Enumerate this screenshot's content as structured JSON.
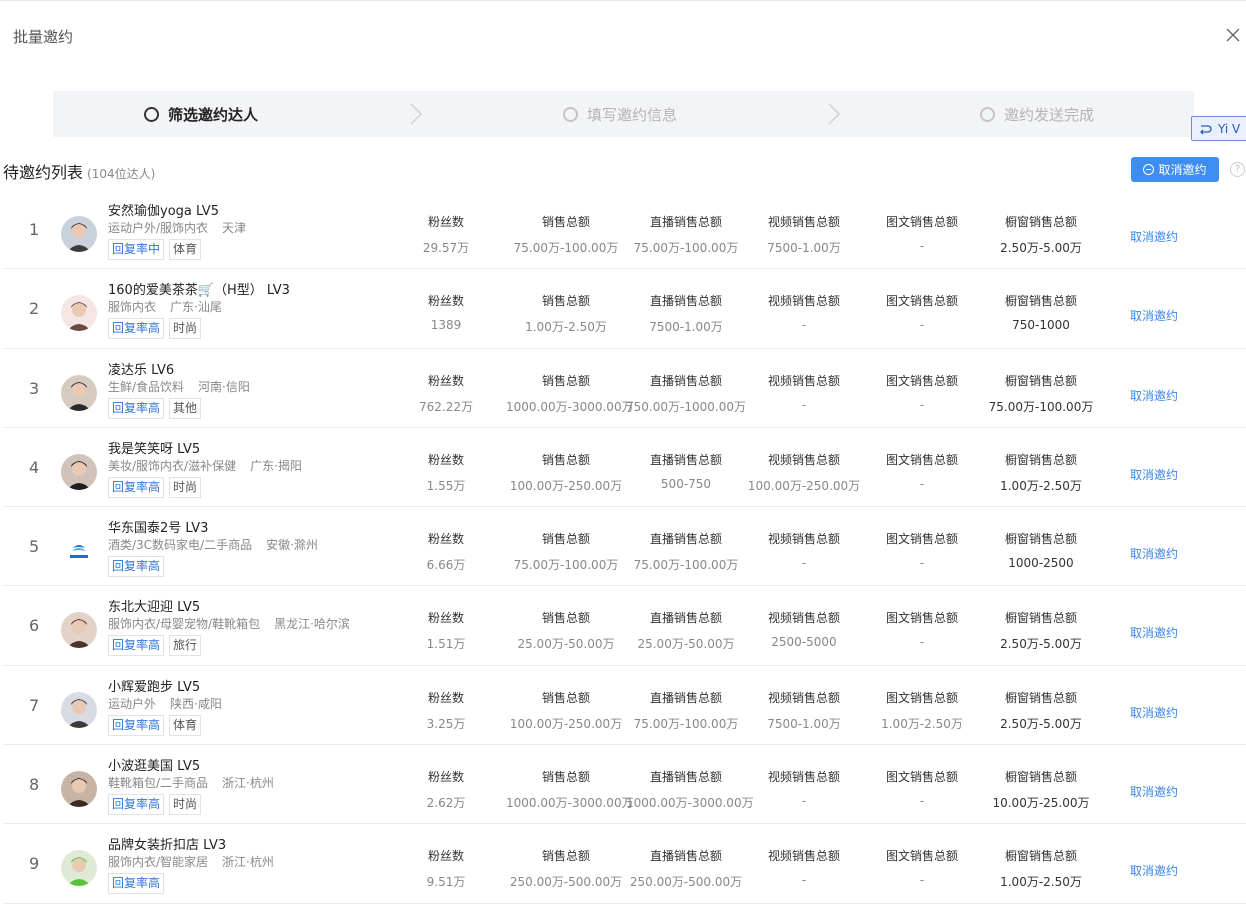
{
  "modal": {
    "title": "批量邀约"
  },
  "steps": [
    {
      "label": "筛选邀约达人"
    },
    {
      "label": "填写邀约信息"
    },
    {
      "label": "邀约发送完成"
    }
  ],
  "side_tab": {
    "label": "Yi V"
  },
  "list": {
    "title": "待邀约列表",
    "count": "(104位达人)",
    "cancel_all_label": "取消邀约",
    "help": "?",
    "stat_labels": [
      "粉丝数",
      "销售总额",
      "直播销售总额",
      "视频销售总额",
      "图文销售总额",
      "橱窗销售总额"
    ],
    "action_label": "取消邀约",
    "rows": [
      {
        "index": "1",
        "name": "安然瑜伽yoga LV5",
        "category": "运动户外/服饰内衣",
        "location": "天津",
        "tags": [
          "回复率中",
          "体育"
        ],
        "values": [
          "29.57万",
          "75.00万-100.00万",
          "75.00万-100.00万",
          "7500-1.00万",
          "-",
          "2.50万-5.00万"
        ]
      },
      {
        "index": "2",
        "name": "160的爱美茶茶🛒（H型） LV3",
        "category": "服饰内衣",
        "location": "广东·汕尾",
        "tags": [
          "回复率高",
          "时尚"
        ],
        "values": [
          "1389",
          "1.00万-2.50万",
          "7500-1.00万",
          "-",
          "-",
          "750-1000"
        ]
      },
      {
        "index": "3",
        "name": "凌达乐 LV6",
        "category": "生鲜/食品饮料",
        "location": "河南·信阳",
        "tags": [
          "回复率高",
          "其他"
        ],
        "values": [
          "762.22万",
          "1000.00万-3000.00万",
          "750.00万-1000.00万",
          "-",
          "-",
          "75.00万-100.00万"
        ]
      },
      {
        "index": "4",
        "name": "我是笑笑呀 LV5",
        "category": "美妆/服饰内衣/滋补保健",
        "location": "广东·揭阳",
        "tags": [
          "回复率高",
          "时尚"
        ],
        "values": [
          "1.55万",
          "100.00万-250.00万",
          "500-750",
          "100.00万-250.00万",
          "-",
          "1.00万-2.50万"
        ]
      },
      {
        "index": "5",
        "name": "华东国泰2号 LV3",
        "category": "酒类/3C数码家电/二手商品",
        "location": "安徽·滁州",
        "tags": [
          "回复率高"
        ],
        "values": [
          "6.66万",
          "75.00万-100.00万",
          "75.00万-100.00万",
          "-",
          "-",
          "1000-2500"
        ]
      },
      {
        "index": "6",
        "name": "东北大迎迎 LV5",
        "category": "服饰内衣/母婴宠物/鞋靴箱包",
        "location": "黑龙江·哈尔滨",
        "tags": [
          "回复率高",
          "旅行"
        ],
        "values": [
          "1.51万",
          "25.00万-50.00万",
          "25.00万-50.00万",
          "2500-5000",
          "-",
          "2.50万-5.00万"
        ]
      },
      {
        "index": "7",
        "name": "小辉爱跑步 LV5",
        "category": "运动户外",
        "location": "陕西·咸阳",
        "tags": [
          "回复率高",
          "体育"
        ],
        "values": [
          "3.25万",
          "100.00万-250.00万",
          "75.00万-100.00万",
          "7500-1.00万",
          "1.00万-2.50万",
          "2.50万-5.00万"
        ]
      },
      {
        "index": "8",
        "name": "小波逛美国 LV5",
        "category": "鞋靴箱包/二手商品",
        "location": "浙江·杭州",
        "tags": [
          "回复率高",
          "时尚"
        ],
        "values": [
          "2.62万",
          "1000.00万-3000.00万",
          "1000.00万-3000.00万",
          "-",
          "-",
          "10.00万-25.00万"
        ]
      },
      {
        "index": "9",
        "name": "品牌女装折扣店 LV3",
        "category": "服饰内衣/智能家居",
        "location": "浙江·杭州",
        "tags": [
          "回复率高"
        ],
        "values": [
          "9.51万",
          "250.00万-500.00万",
          "250.00万-500.00万",
          "-",
          "-",
          "1.00万-2.50万"
        ]
      }
    ]
  },
  "colors": {
    "accent": "#3d8ef0",
    "link": "#3b86e6",
    "tag_blue": "#2f74d8"
  }
}
